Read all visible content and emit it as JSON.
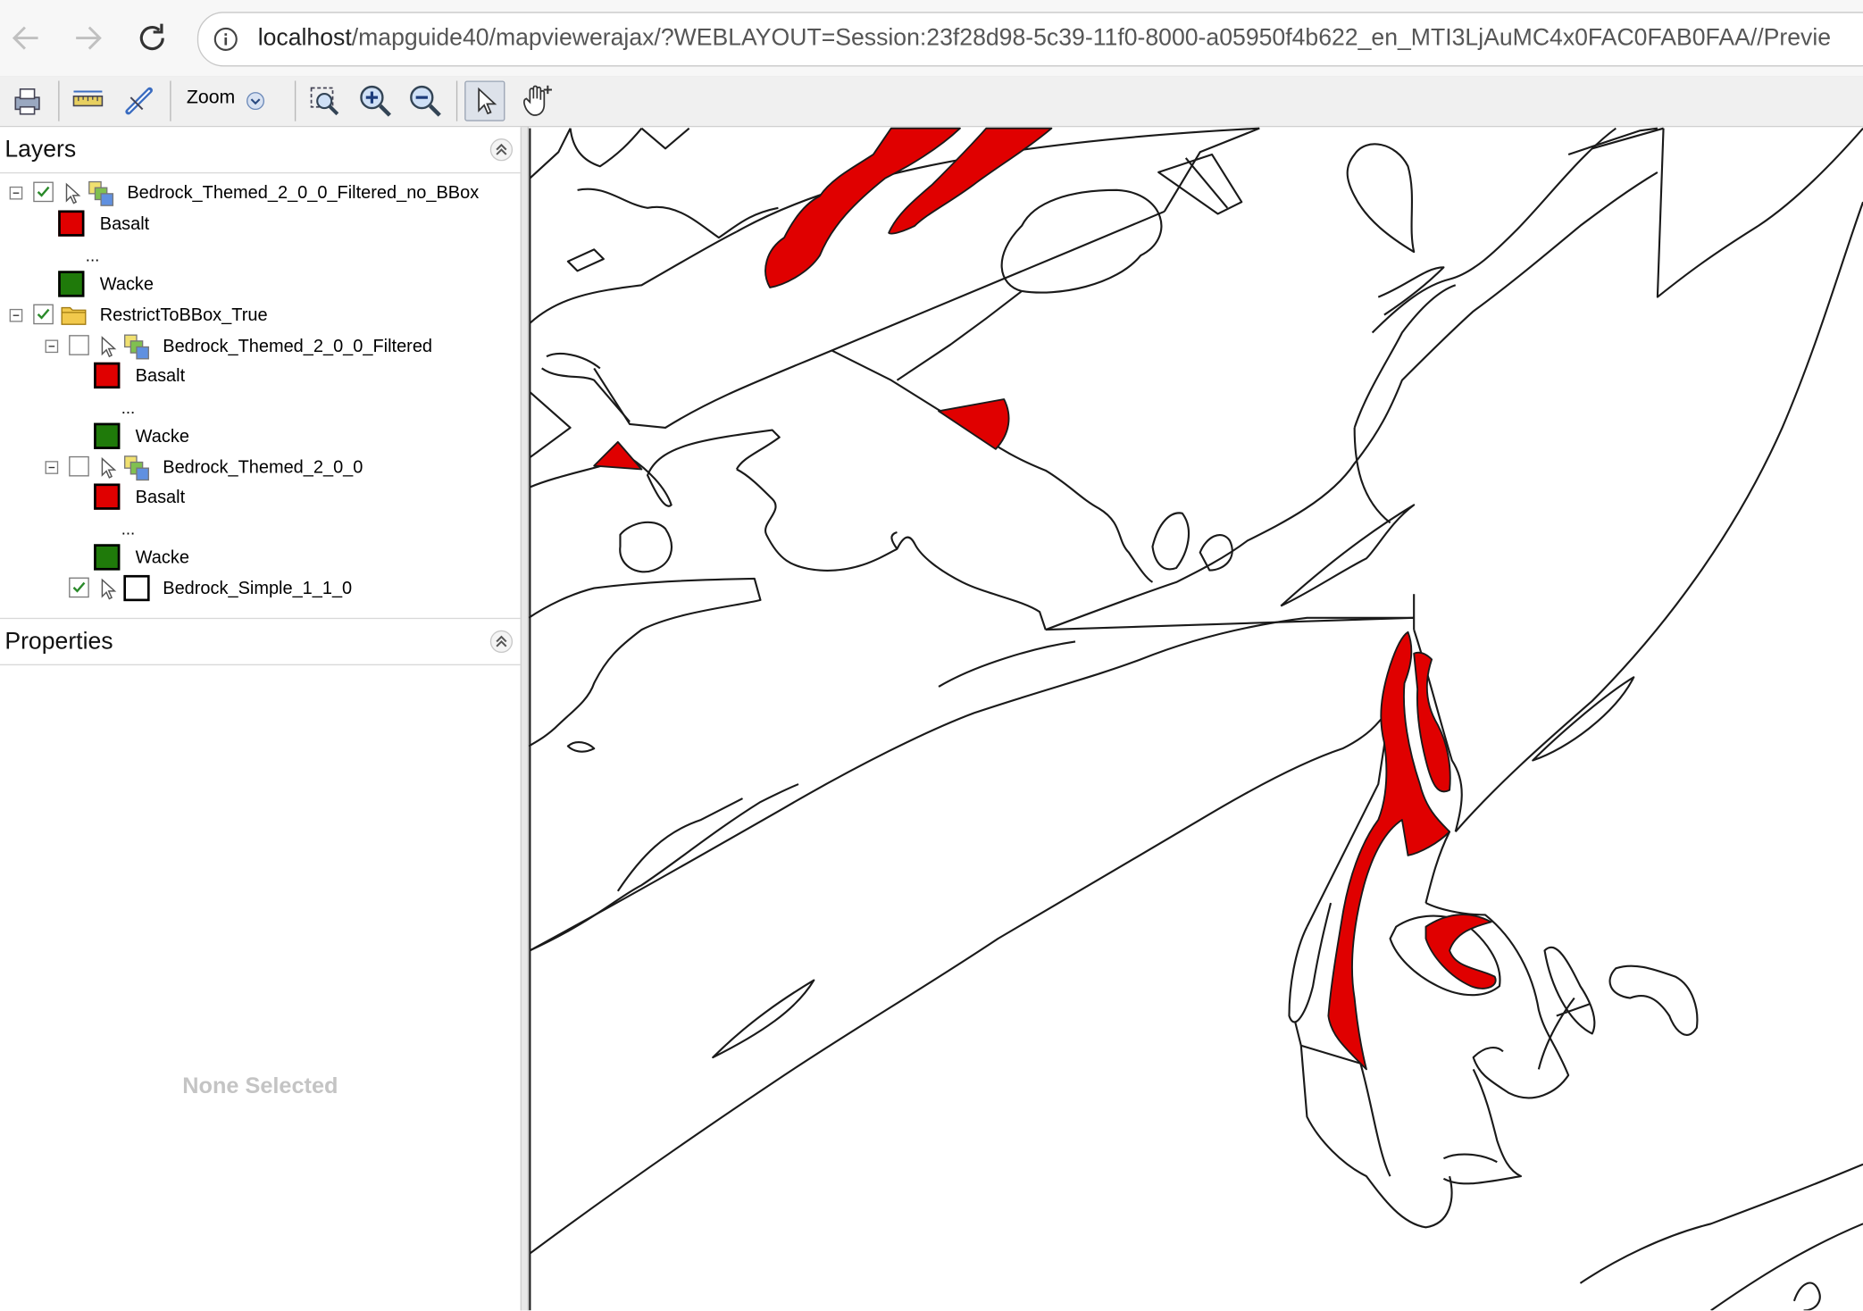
{
  "browser": {
    "url_host": "localhost",
    "url_rest": "/mapguide40/mapviewerajax/?WEBLAYOUT=Session:23f28d98-5c39-11f0-8000-a05950f4b622_en_MTI3LjAuMC4x0FAC0FAB0FAA//Previe"
  },
  "toolbar": {
    "zoom_label": "Zoom",
    "buttons": [
      "print-icon",
      "measure-icon",
      "buffer-icon",
      "zoom-dropdown",
      "zoom-rect-icon",
      "zoom-in-icon",
      "zoom-out-icon",
      "select-icon",
      "pan-icon"
    ]
  },
  "layers_panel": {
    "title": "Layers",
    "items": [
      {
        "name": "Bedrock_Themed_2_0_0_Filtered_no_BBox",
        "checked": true
      },
      {
        "name": "Basalt"
      },
      {
        "name": "..."
      },
      {
        "name": "Wacke"
      },
      {
        "name": "RestrictToBBox_True",
        "checked": true
      },
      {
        "name": "Bedrock_Themed_2_0_0_Filtered",
        "checked": false
      },
      {
        "name": "Basalt"
      },
      {
        "name": "..."
      },
      {
        "name": "Wacke"
      },
      {
        "name": "Bedrock_Themed_2_0_0",
        "checked": false
      },
      {
        "name": "Basalt"
      },
      {
        "name": "..."
      },
      {
        "name": "Wacke"
      },
      {
        "name": "Bedrock_Simple_1_1_0",
        "checked": true
      }
    ]
  },
  "properties_panel": {
    "title": "Properties",
    "empty_text": "None Selected"
  },
  "colors": {
    "basalt": "#e00000",
    "wacke": "#1f7a0a",
    "map_line": "#1a1a1a"
  }
}
